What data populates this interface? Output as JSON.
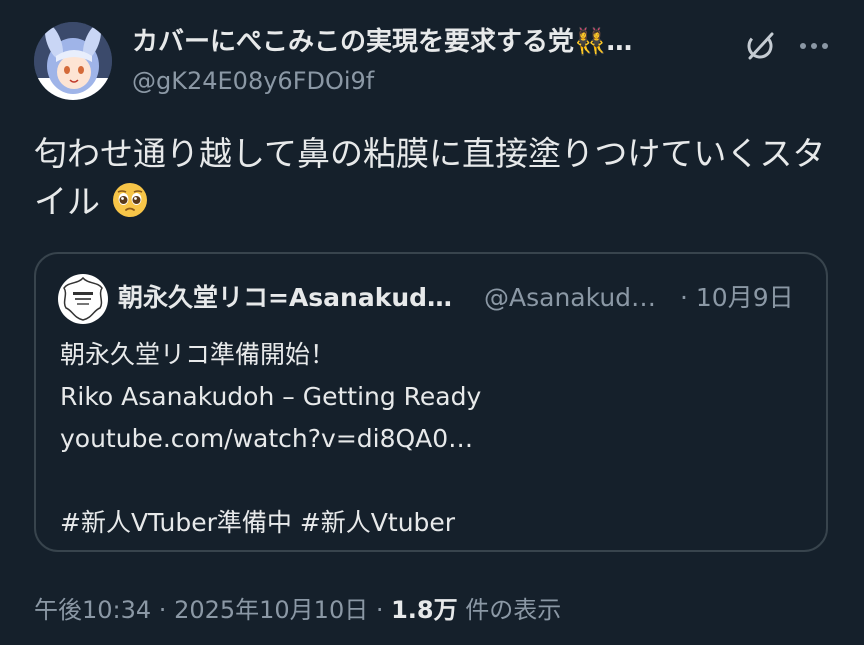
{
  "author": {
    "display_name": "カバーにぺこみこの実現を要求する党👯‍♀️…",
    "handle": "@gK24E08y6FDOi9f",
    "avatar_icon": "anime-avatar"
  },
  "actions": {
    "grok_icon": "grok-icon",
    "more_icon": "more-icon"
  },
  "tweet": {
    "text": "匂わせ通り越して鼻の粘膜に直接塗りつけていくスタイル",
    "emoji": "pleading-face"
  },
  "quote": {
    "display_name": "朝永久堂リコ=Asanakud…",
    "handle": "@Asanakud…",
    "date": "· 10月9日",
    "lines": [
      "朝永久堂リコ準備開始！",
      "Riko Asanakudoh – Getting Ready",
      "youtube.com/watch?v=di8QA0…",
      "",
      "#新人VTuber準備中 #新人Vtuber"
    ]
  },
  "footer": {
    "time": "午後10:34",
    "sep1": " · ",
    "date": "2025年10月10日",
    "sep2": " · ",
    "views_count": "1.8万",
    "views_label": " 件の表示"
  },
  "colors": {
    "background": "#15202b",
    "text_primary": "#e7e9ea",
    "text_secondary": "#8b98a5",
    "border": "#38444d"
  }
}
